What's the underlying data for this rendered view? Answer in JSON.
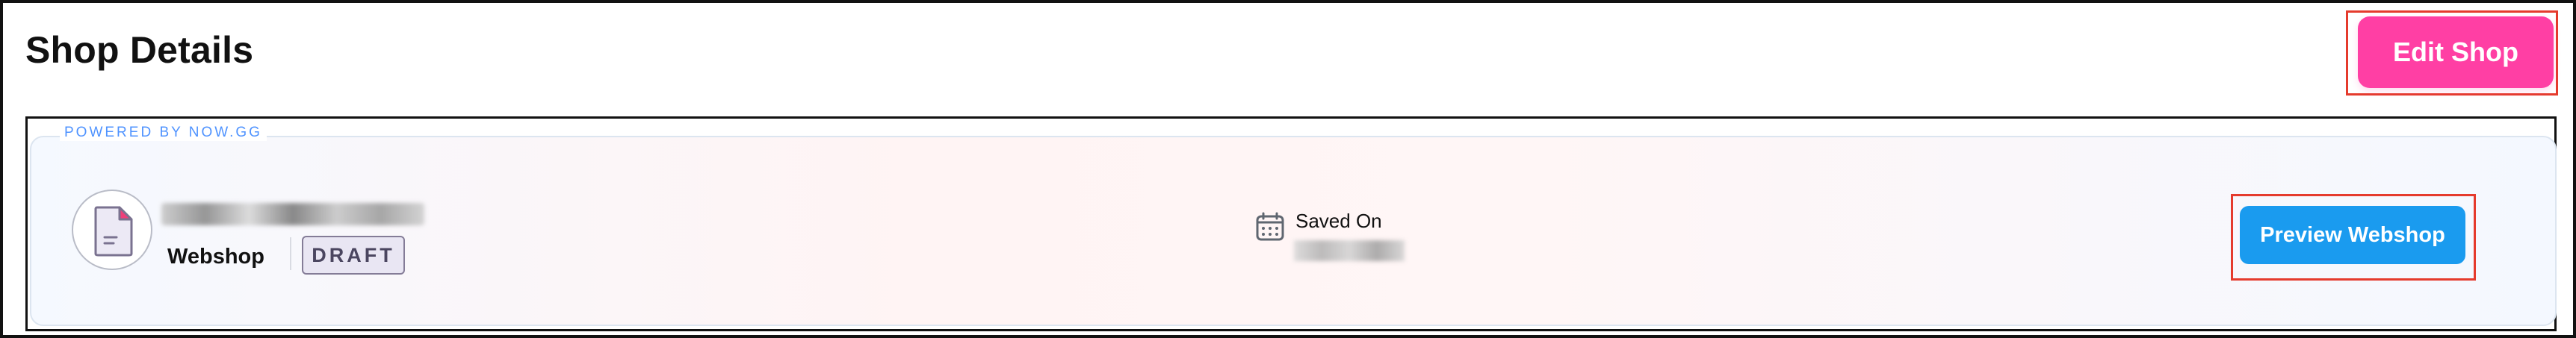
{
  "header": {
    "title": "Shop Details",
    "edit_label": "Edit Shop"
  },
  "card": {
    "powered_by": "POWERED BY NOW.GG",
    "shop_type": "Webshop",
    "status": "DRAFT",
    "saved_label": "Saved On",
    "preview_label": "Preview Webshop"
  },
  "colors": {
    "edit_button": "#ff3fa4",
    "preview_button": "#1a9bef",
    "highlight_border": "#e53b2d",
    "powered_text": "#4f93ff",
    "badge_bg": "#e9e6f3",
    "badge_border": "#847c97"
  },
  "icons": {
    "shop": "document-icon",
    "saved": "calendar-icon"
  }
}
